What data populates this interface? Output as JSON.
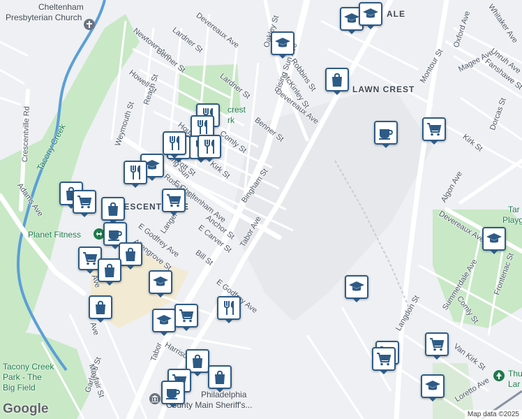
{
  "map": {
    "colors": {
      "park": "#c8e8c6",
      "road": "#ffffff",
      "water": "#5b9fd6",
      "marker_border": "#2e5b86",
      "marker_icon": "#2e5b86"
    },
    "streets": [
      "Devereaux Ave",
      "Lardner St",
      "Newtown Ave",
      "Benner St",
      "Howell St",
      "Reach St",
      "Weymouth St",
      "Oakley St",
      "Robbins St",
      "McKinley St",
      "Rising Sun Ave",
      "Lardner St",
      "Devereaux Ave",
      "Benner St",
      "Comly St",
      "Alcott St",
      "Kirk St",
      "Bingham St",
      "Rosalie St",
      "E Cheltenham Ave",
      "Anchor St",
      "Tabor Ave",
      "E Carver St",
      "Bill St",
      "E Godfrey Ave",
      "Allengrove St",
      "Langer St",
      "E Godfrey Ave",
      "Crescentville Rd",
      "Adams Ave",
      "Oxford Ave",
      "Magee Ave",
      "Unruh Ave",
      "Fanshawe St",
      "Montour St",
      "Algon Ave",
      "Devereaux Ave",
      "Summerdale Ave",
      "Frontenac St",
      "Comly St",
      "Langdon St",
      "Van Kirk St",
      "Dorcas St",
      "Loretto Ave",
      "Garland St",
      "Mayfair St",
      "Harrison St",
      "Tabor",
      "Ave",
      "Ave",
      "Rising Sun",
      "Whitaker Ave",
      "Kirk St",
      "Bingham St",
      "Houston St"
    ],
    "areas": {
      "lawncrest": "LAWN CREST",
      "crescentville": "CRESCENTVILLE",
      "fox_chase_frag": "ALE"
    },
    "pois": {
      "church": "Cheltenham\nPresbyterian Church",
      "church_top": "Cheltenham",
      "church_bottom": "Presbyterian Church",
      "planet_fitness": "Planet Fitness",
      "tacony_creek": "Tacony Creek",
      "tacony_park_1": "Tacony Creek",
      "tacony_park_2": "Park - The",
      "tacony_park_3": "Big Field",
      "sheriff_1": "Philadelphia",
      "sheriff_2": "County Main Sheriff's...",
      "park_label": "crest",
      "park_label_2": "rk",
      "playground": "Tar",
      "playground_2": "Playg",
      "thu_1": "Thu",
      "thu_2": "Lar"
    },
    "markers": [
      {
        "icon": "school-icon"
      },
      {
        "icon": "school-icon"
      },
      {
        "icon": "school-icon"
      },
      {
        "icon": "shopping-bag-icon"
      },
      {
        "icon": "restaurant-icon"
      },
      {
        "icon": "restaurant-icon"
      },
      {
        "icon": "restaurant-icon"
      },
      {
        "icon": "restaurant-icon"
      },
      {
        "icon": "restaurant-icon"
      },
      {
        "icon": "restaurant-icon"
      },
      {
        "icon": "school-icon"
      },
      {
        "icon": "restaurant-icon"
      },
      {
        "icon": "shopping-bag-icon"
      },
      {
        "icon": "shopping-cart-icon"
      },
      {
        "icon": "shopping-cart-icon"
      },
      {
        "icon": "shopping-bag-icon"
      },
      {
        "icon": "coffee-icon"
      },
      {
        "icon": "shopping-bag-icon"
      },
      {
        "icon": "shopping-cart-icon"
      },
      {
        "icon": "shopping-bag-icon"
      },
      {
        "icon": "school-icon"
      },
      {
        "icon": "shopping-bag-icon"
      },
      {
        "icon": "school-icon"
      },
      {
        "icon": "shopping-cart-icon"
      },
      {
        "icon": "restaurant-icon"
      },
      {
        "icon": "shopping-bag-icon"
      },
      {
        "icon": "shopping-cart-icon"
      },
      {
        "icon": "shopping-bag-icon"
      },
      {
        "icon": "coffee-icon"
      },
      {
        "icon": "coffee-icon"
      },
      {
        "icon": "shopping-cart-icon"
      },
      {
        "icon": "school-icon"
      },
      {
        "icon": "school-icon"
      },
      {
        "icon": "shopping-cart-icon"
      },
      {
        "icon": "shopping-cart-icon"
      },
      {
        "icon": "shopping-cart-icon"
      },
      {
        "icon": "school-icon"
      }
    ],
    "logo": "Google",
    "attribution": "Map data ©2025"
  }
}
